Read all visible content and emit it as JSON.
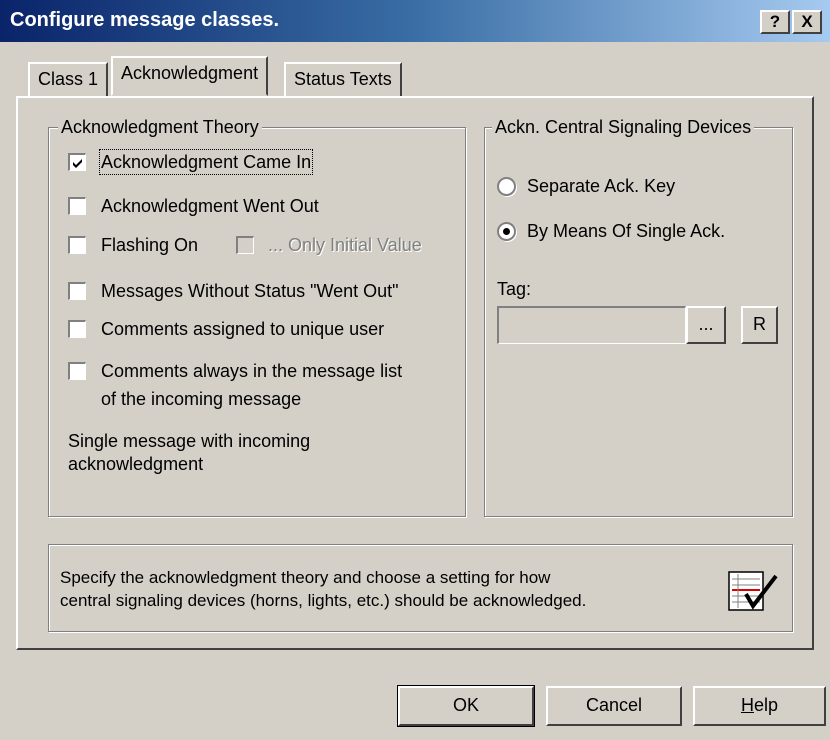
{
  "window": {
    "title": "Configure message classes.",
    "help_button": "?",
    "close_button": "X"
  },
  "tabs": [
    {
      "label": "Class 1",
      "active": false
    },
    {
      "label": "Acknowledgment",
      "active": true
    },
    {
      "label": "Status Texts",
      "active": false
    }
  ],
  "ack_theory": {
    "legend": "Acknowledgment Theory",
    "options": [
      {
        "label": "Acknowledgment Came In",
        "checked": true,
        "enabled": true
      },
      {
        "label": "Acknowledgment Went Out",
        "checked": false,
        "enabled": true
      },
      {
        "label": "Flashing On",
        "checked": false,
        "enabled": true
      },
      {
        "label": "... Only Initial Value",
        "checked": false,
        "enabled": false
      },
      {
        "label": "Messages Without Status \"Went Out\"",
        "checked": false,
        "enabled": true
      },
      {
        "label": "Comments assigned to unique user",
        "checked": false,
        "enabled": true
      },
      {
        "label_line1": "Comments always in the message list",
        "label_line2": "of the incoming message",
        "checked": false,
        "enabled": true
      }
    ],
    "info_line1": "Single message with incoming",
    "info_line2": "acknowledgment"
  },
  "signaling": {
    "legend": "Ackn. Central Signaling Devices",
    "options": [
      {
        "label": "Separate Ack. Key",
        "selected": false
      },
      {
        "label": "By Means Of Single Ack.",
        "selected": true
      }
    ],
    "tag_label": "Tag:",
    "tag_value": "",
    "browse_button": "...",
    "r_button": "R"
  },
  "description": {
    "line1": "Specify the acknowledgment theory and choose a setting for how",
    "line2": "central signaling devices (horns, lights, etc.) should be acknowledged.",
    "icon": "checklist-icon"
  },
  "buttons": {
    "ok": "OK",
    "cancel": "Cancel",
    "help_prefix": "H",
    "help_rest": "elp"
  }
}
